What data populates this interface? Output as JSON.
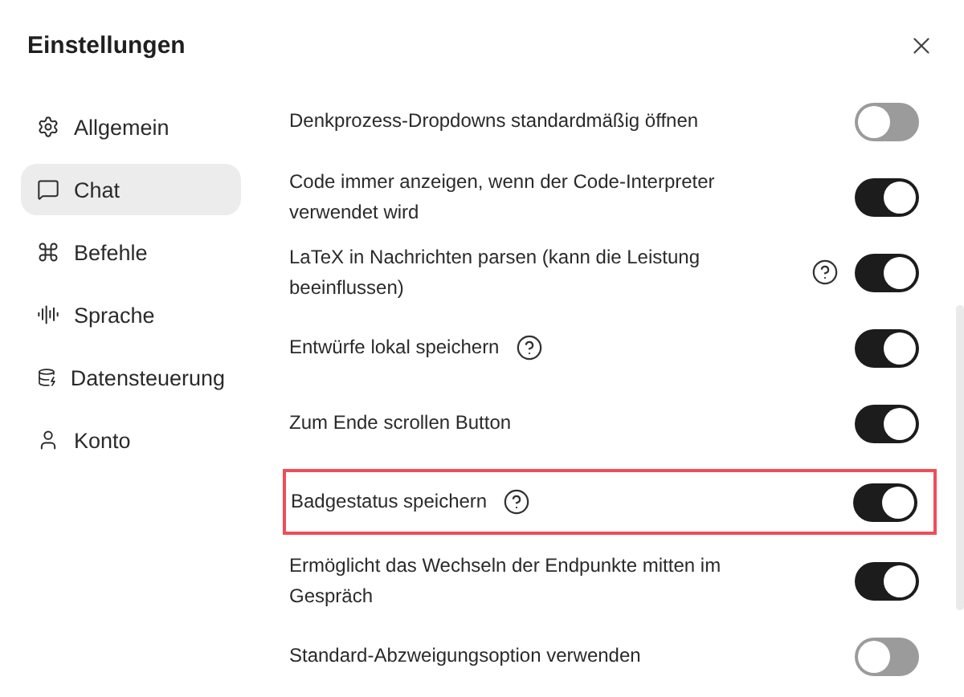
{
  "dialog": {
    "title": "Einstellungen"
  },
  "sidebar": {
    "items": [
      {
        "label": "Allgemein",
        "selected": false
      },
      {
        "label": "Chat",
        "selected": true
      },
      {
        "label": "Befehle",
        "selected": false
      },
      {
        "label": "Sprache",
        "selected": false
      },
      {
        "label": "Datensteuerung",
        "selected": false
      },
      {
        "label": "Konto",
        "selected": false
      }
    ]
  },
  "settings": [
    {
      "label": "Denkprozess-Dropdowns standardmäßig öffnen",
      "help": false,
      "on": false,
      "highlighted": false
    },
    {
      "label": "Code immer anzeigen, wenn der Code-Interpreter verwendet wird",
      "help": false,
      "on": true,
      "highlighted": false
    },
    {
      "label": "LaTeX in Nachrichten parsen (kann die Leistung beeinflussen)",
      "help": true,
      "on": true,
      "highlighted": false
    },
    {
      "label": "Entwürfe lokal speichern",
      "help": true,
      "on": true,
      "highlighted": false
    },
    {
      "label": "Zum Ende scrollen Button",
      "help": false,
      "on": true,
      "highlighted": false
    },
    {
      "label": "Badgestatus speichern",
      "help": true,
      "on": true,
      "highlighted": true
    },
    {
      "label": "Ermöglicht das Wechseln der Endpunkte mitten im Gespräch",
      "help": false,
      "on": true,
      "highlighted": false
    },
    {
      "label": "Standard-Abzweigungsoption verwenden",
      "help": false,
      "on": false,
      "highlighted": false
    }
  ]
}
